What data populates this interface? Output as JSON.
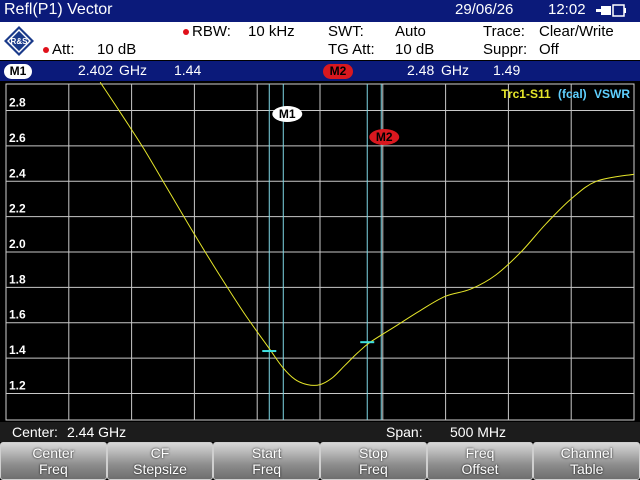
{
  "titlebar": {
    "title": "Refl(P1) Vector",
    "date": "29/06/26",
    "time": "12:02",
    "battery_icon": "battery-plug-icon"
  },
  "settings": {
    "logo_text": "R&S",
    "att_label": "Att:",
    "att_value": "10 dB",
    "rbw_label": "RBW:",
    "rbw_value": "10 kHz",
    "swt_label": "SWT:",
    "swt_value": "Auto",
    "tg_att_label": "TG Att:",
    "tg_att_value": "10 dB",
    "trace_label": "Trace:",
    "trace_value": "Clear/Write",
    "suppr_label": "Suppr:",
    "suppr_value": "Off"
  },
  "markers": {
    "m1": {
      "label": "M1",
      "freq": "2.402",
      "unit": "GHz",
      "value": "1.44"
    },
    "m2": {
      "label": "M2",
      "freq": "2.48",
      "unit": "GHz",
      "value": "1.49"
    }
  },
  "info": {
    "center_label": "Center:",
    "center_value": "2.44 GHz",
    "span_label": "Span:",
    "span_value": "500 MHz"
  },
  "softkeys": [
    {
      "line1": "Center",
      "line2": "Freq"
    },
    {
      "line1": "CF",
      "line2": "Stepsize"
    },
    {
      "line1": "Start",
      "line2": "Freq"
    },
    {
      "line1": "Stop",
      "line2": "Freq"
    },
    {
      "line1": "Freq",
      "line2": "Offset"
    },
    {
      "line1": "Channel",
      "line2": "Table"
    }
  ],
  "colors": {
    "header_blue": "#0b1a7a",
    "trace": "#e6e62a",
    "marker_line": "#7fd8e6",
    "m2_badge": "#d9181f",
    "trace_label_yellow": "#e6e62a",
    "trace_label_cyan": "#5fd0ff"
  },
  "chart_data": {
    "type": "line",
    "trace_label": {
      "part1": "Trc1-S11",
      "part2": "(fcal)",
      "part3": "VSWR"
    },
    "x_unit": "GHz",
    "xlim": [
      2.19,
      2.69
    ],
    "ylim": [
      1.05,
      2.95
    ],
    "yticks": [
      "1.2",
      "1.4",
      "1.6",
      "1.8",
      "2.0",
      "2.2",
      "2.4",
      "2.6",
      "2.8"
    ],
    "grid": true,
    "series": [
      {
        "x": [
          2.265,
          2.28,
          2.3,
          2.32,
          2.34,
          2.36,
          2.38,
          2.4,
          2.41,
          2.42,
          2.43,
          2.44,
          2.45,
          2.46,
          2.47,
          2.48,
          2.5,
          2.52,
          2.54,
          2.56,
          2.58,
          2.6,
          2.62,
          2.64,
          2.66,
          2.69
        ],
        "y": [
          2.96,
          2.8,
          2.58,
          2.34,
          2.1,
          1.87,
          1.65,
          1.45,
          1.35,
          1.28,
          1.25,
          1.25,
          1.29,
          1.36,
          1.43,
          1.49,
          1.58,
          1.67,
          1.75,
          1.79,
          1.87,
          2.0,
          2.16,
          2.3,
          2.4,
          2.44
        ]
      }
    ],
    "markers": [
      {
        "label": "M1",
        "x": 2.402,
        "y": 1.44
      },
      {
        "label": "M2",
        "x": 2.48,
        "y": 1.49
      }
    ]
  }
}
